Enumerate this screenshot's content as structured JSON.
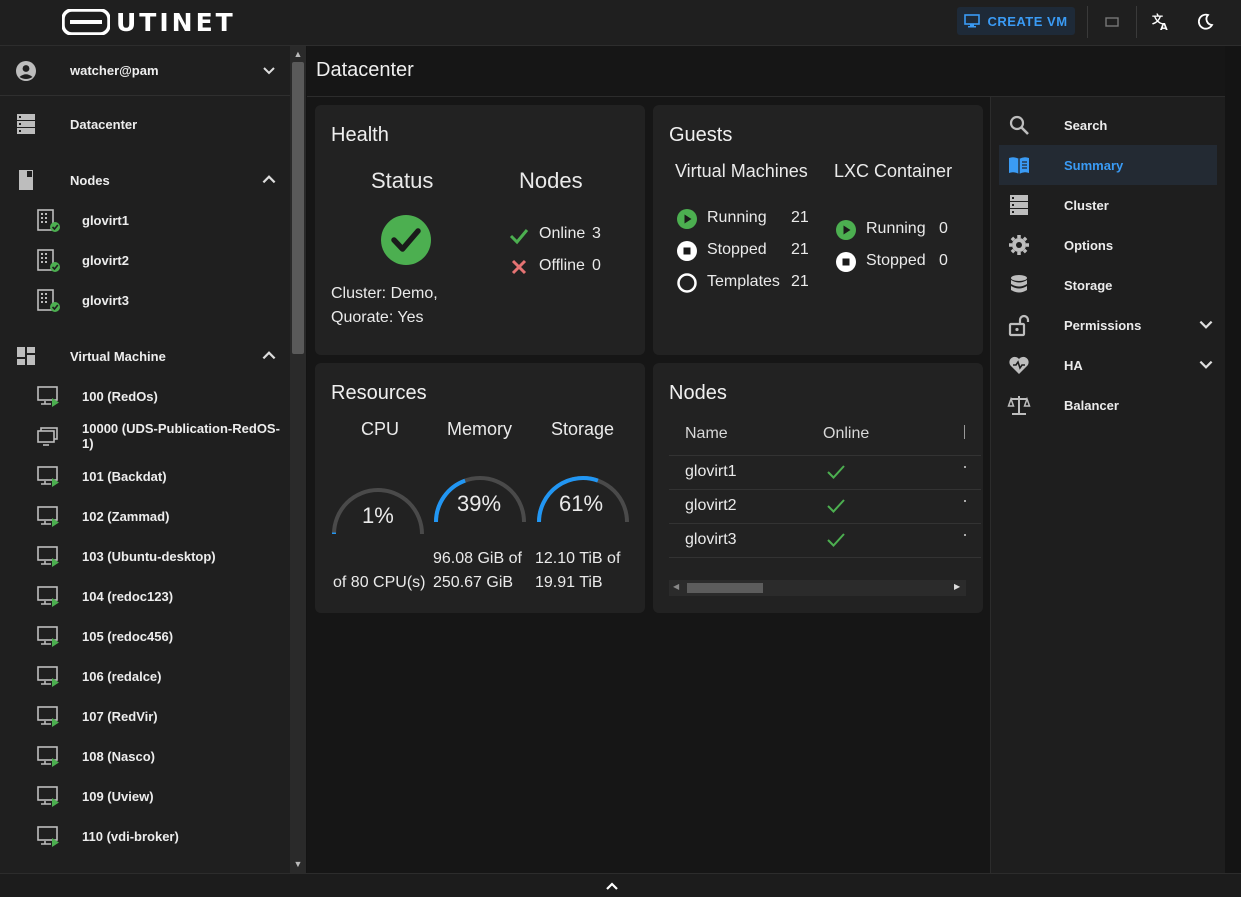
{
  "header": {
    "logo_text": "UTINET",
    "create_vm_label": "CREATE VM",
    "icons": [
      "monitor-icon",
      "window-icon",
      "translate-icon",
      "theme-toggle-icon"
    ]
  },
  "sidebar": {
    "user": "watcher@pam",
    "items": [
      {
        "label": "Datacenter",
        "icon": "server-stack-icon"
      },
      {
        "label": "Nodes",
        "icon": "nodes-icon"
      },
      {
        "label": "Virtual Machine",
        "icon": "dashboard-grid-icon"
      }
    ],
    "nodes": [
      "glovirt1",
      "glovirt2",
      "glovirt3"
    ],
    "vms": [
      "100 (RedOs)",
      "10000 (UDS-Publication-RedOS-1)",
      "101 (Backdat)",
      "102 (Zammad)",
      "103 (Ubuntu-desktop)",
      "104 (redoc123)",
      "105 (redoc456)",
      "106 (redalce)",
      "107 (RedVir)",
      "108 (Nasco)",
      "109 (Uview)",
      "110 (vdi-broker)"
    ]
  },
  "main": {
    "title": "Datacenter",
    "health": {
      "title": "Health",
      "status_heading": "Status",
      "nodes_heading": "Nodes",
      "cluster_line": "Cluster: Demo,",
      "quorate_line": "Quorate: Yes",
      "online_label": "Online",
      "online_count": "3",
      "offline_label": "Offline",
      "offline_count": "0"
    },
    "guests": {
      "title": "Guests",
      "vm_heading": "Virtual Machines",
      "lxc_heading": "LXC Container",
      "vm_running_label": "Running",
      "vm_running": "21",
      "vm_stopped_label": "Stopped",
      "vm_stopped": "21",
      "vm_templates_label": "Templates",
      "vm_templates": "21",
      "lxc_running_label": "Running",
      "lxc_running": "0",
      "lxc_stopped_label": "Stopped",
      "lxc_stopped": "0"
    },
    "resources": {
      "title": "Resources",
      "cpu_heading": "CPU",
      "memory_heading": "Memory",
      "storage_heading": "Storage",
      "cpu_percent": 1,
      "memory_percent": 39,
      "storage_percent": 61,
      "cpu_value": "1%",
      "memory_value": "39%",
      "storage_value": "61%",
      "cpu_detail": "of 80 CPU(s)",
      "memory_detail_1": "96.08 GiB of",
      "memory_detail_2": "250.67 GiB",
      "storage_detail_1": "12.10 TiB of",
      "storage_detail_2": "19.91 TiB",
      "gauge_color": "#2196f3"
    },
    "nodes_table": {
      "title": "Nodes",
      "columns": [
        "Name",
        "Online"
      ],
      "rows": [
        {
          "name": "glovirt1",
          "online": true
        },
        {
          "name": "glovirt2",
          "online": true
        },
        {
          "name": "glovirt3",
          "online": true
        }
      ]
    }
  },
  "right_nav": {
    "items": [
      {
        "label": "Search",
        "icon": "search-icon"
      },
      {
        "label": "Summary",
        "icon": "book-icon",
        "active": true
      },
      {
        "label": "Cluster",
        "icon": "server-stack-icon"
      },
      {
        "label": "Options",
        "icon": "gear-icon"
      },
      {
        "label": "Storage",
        "icon": "database-icon"
      },
      {
        "label": "Permissions",
        "icon": "unlock-icon"
      },
      {
        "label": "HA",
        "icon": "heart-pulse-icon"
      },
      {
        "label": "Balancer",
        "icon": "scale-icon"
      }
    ]
  },
  "colors": {
    "accent": "#3a9bf5",
    "ok_green": "#4caf50",
    "error_red": "#e57373"
  }
}
